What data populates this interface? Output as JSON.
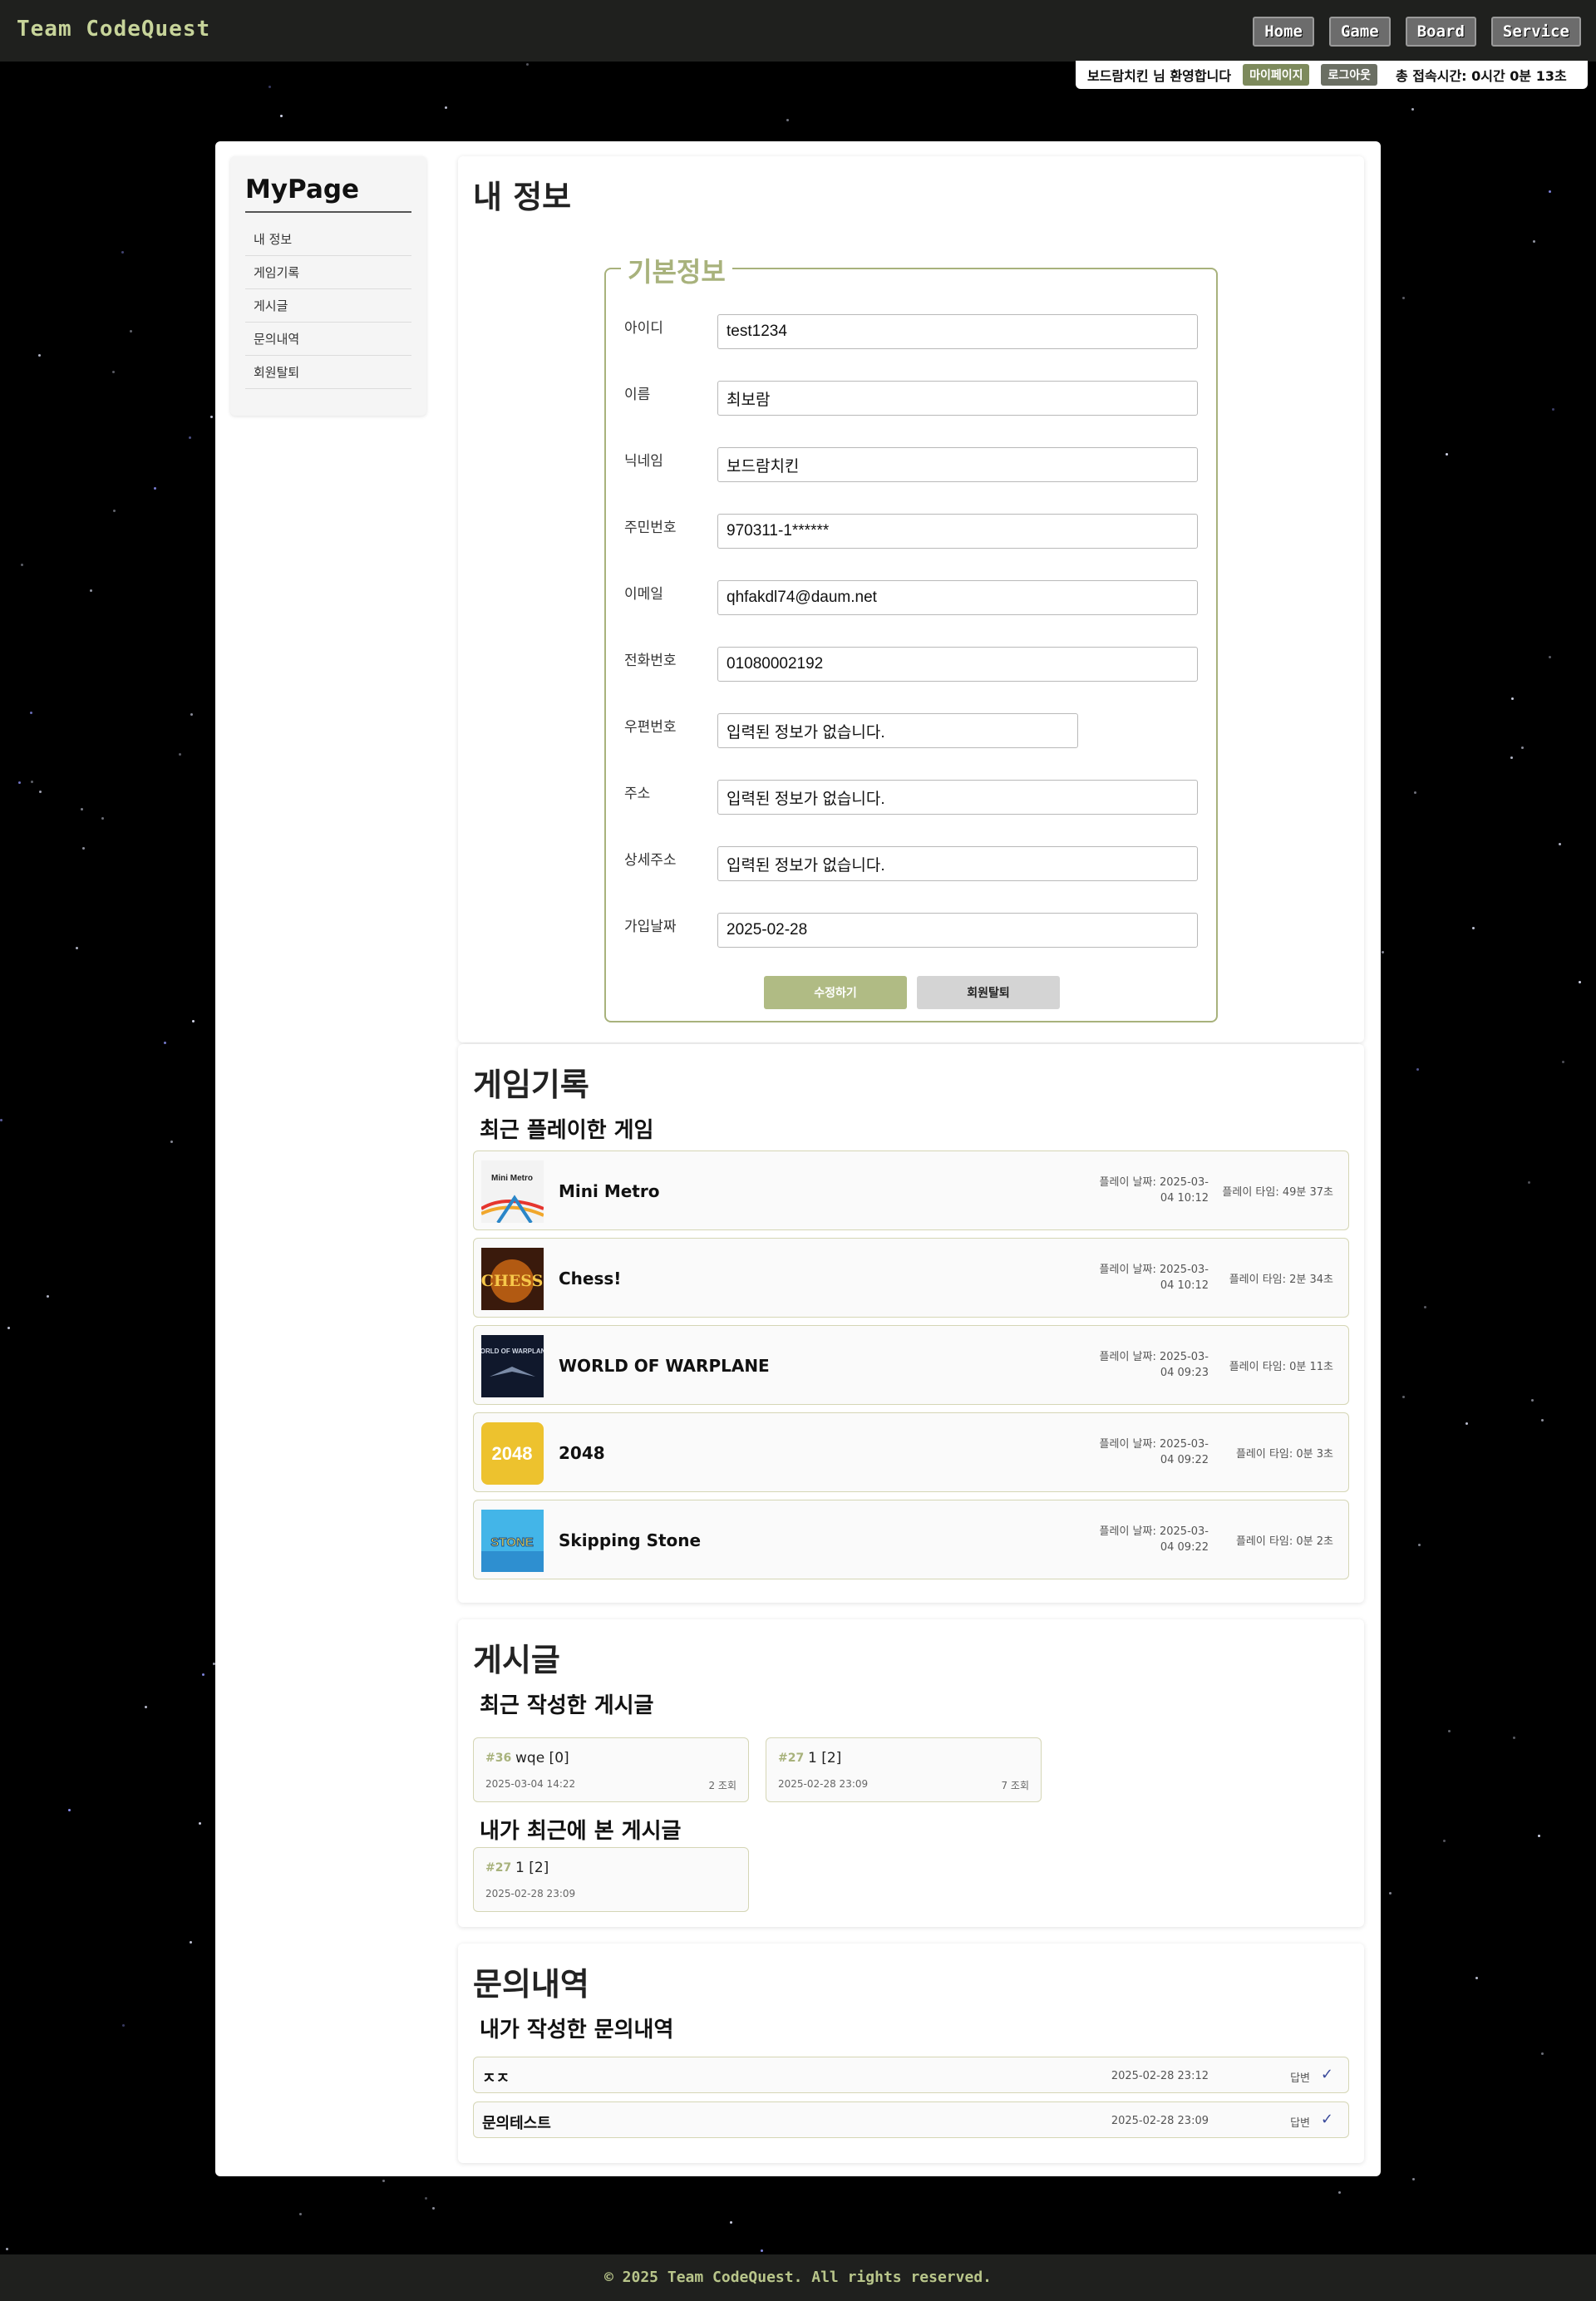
{
  "header": {
    "brand": "Team CodeQuest",
    "nav": [
      "Home",
      "Game",
      "Board",
      "Service"
    ]
  },
  "userbar": {
    "welcome": "보드람치킨 님 환영합니다",
    "mypage": "마이페이지",
    "logout": "로그아웃",
    "session": "총 접속시간: 0시간 0분 13초"
  },
  "sidebar": {
    "title": "MyPage",
    "items": [
      "내 정보",
      "게임기록",
      "게시글",
      "문의내역",
      "회원탈퇴"
    ]
  },
  "info": {
    "heading": "내 정보",
    "legend": "기본정보",
    "fields": [
      {
        "label": "아이디",
        "value": "test1234"
      },
      {
        "label": "이름",
        "value": "최보람"
      },
      {
        "label": "닉네임",
        "value": "보드람치킨"
      },
      {
        "label": "주민번호",
        "value": "970311-1******"
      },
      {
        "label": "이메일",
        "value": "qhfakdl74@daum.net"
      },
      {
        "label": "전화번호",
        "value": "01080002192"
      },
      {
        "label": "우편번호",
        "value": "입력된 정보가 없습니다."
      },
      {
        "label": "주소",
        "value": "입력된 정보가 없습니다."
      },
      {
        "label": "상세주소",
        "value": "입력된 정보가 없습니다."
      },
      {
        "label": "가입날짜",
        "value": "2025-02-28"
      }
    ],
    "edit_button": "수정하기",
    "withdraw_button": "회원탈퇴"
  },
  "games": {
    "heading": "게임기록",
    "subheading": "최근 플레이한 게임",
    "items": [
      {
        "name": "Mini Metro",
        "date_line1": "플레이 날짜: 2025-03-",
        "date_line2": "04 10:12",
        "play": "플레이 타임: 49분 37초",
        "thumb_text": "Mini Metro"
      },
      {
        "name": "Chess!",
        "date_line1": "플레이 날짜: 2025-03-",
        "date_line2": "04 10:12",
        "play": "플레이 타임: 2분 34초",
        "thumb_text": "CHESS"
      },
      {
        "name": "WORLD OF WARPLANE",
        "date_line1": "플레이 날짜: 2025-03-",
        "date_line2": "04 09:23",
        "play": "플레이 타임: 0분 11초",
        "thumb_text": "WORLD OF WARPLANE"
      },
      {
        "name": "2048",
        "date_line1": "플레이 날짜: 2025-03-",
        "date_line2": "04 09:22",
        "play": "플레이 타임: 0분 3초",
        "thumb_text": "2048"
      },
      {
        "name": "Skipping Stone",
        "date_line1": "플레이 날짜: 2025-03-",
        "date_line2": "04 09:22",
        "play": "플레이 타임: 0분 2초",
        "thumb_text": "STONE"
      }
    ]
  },
  "posts": {
    "heading": "게시글",
    "recent_heading": "최근 작성한 게시글",
    "recent": [
      {
        "num": "#36",
        "title": "wqe [0]",
        "date": "2025-03-04 14:22",
        "views": "2 조회"
      },
      {
        "num": "#27",
        "title": "1 [2]",
        "date": "2025-02-28 23:09",
        "views": "7 조회"
      }
    ],
    "viewed_heading": "내가 최근에 본 게시글",
    "viewed": [
      {
        "num": "#27",
        "title": "1 [2]",
        "date": "2025-02-28 23:09"
      }
    ]
  },
  "inquiries": {
    "heading": "문의내역",
    "subheading": "내가 작성한 문의내역",
    "items": [
      {
        "title": "ㅈㅈ",
        "date": "2025-02-28 23:12",
        "status": "답변"
      },
      {
        "title": "문의테스트",
        "date": "2025-02-28 23:09",
        "status": "답변"
      }
    ]
  },
  "footer": "© 2025 Team CodeQuest. All rights reserved.",
  "colors": {
    "accent": "#a8b27c",
    "header_bg": "#1f201e",
    "check": "#3a4a9b"
  }
}
